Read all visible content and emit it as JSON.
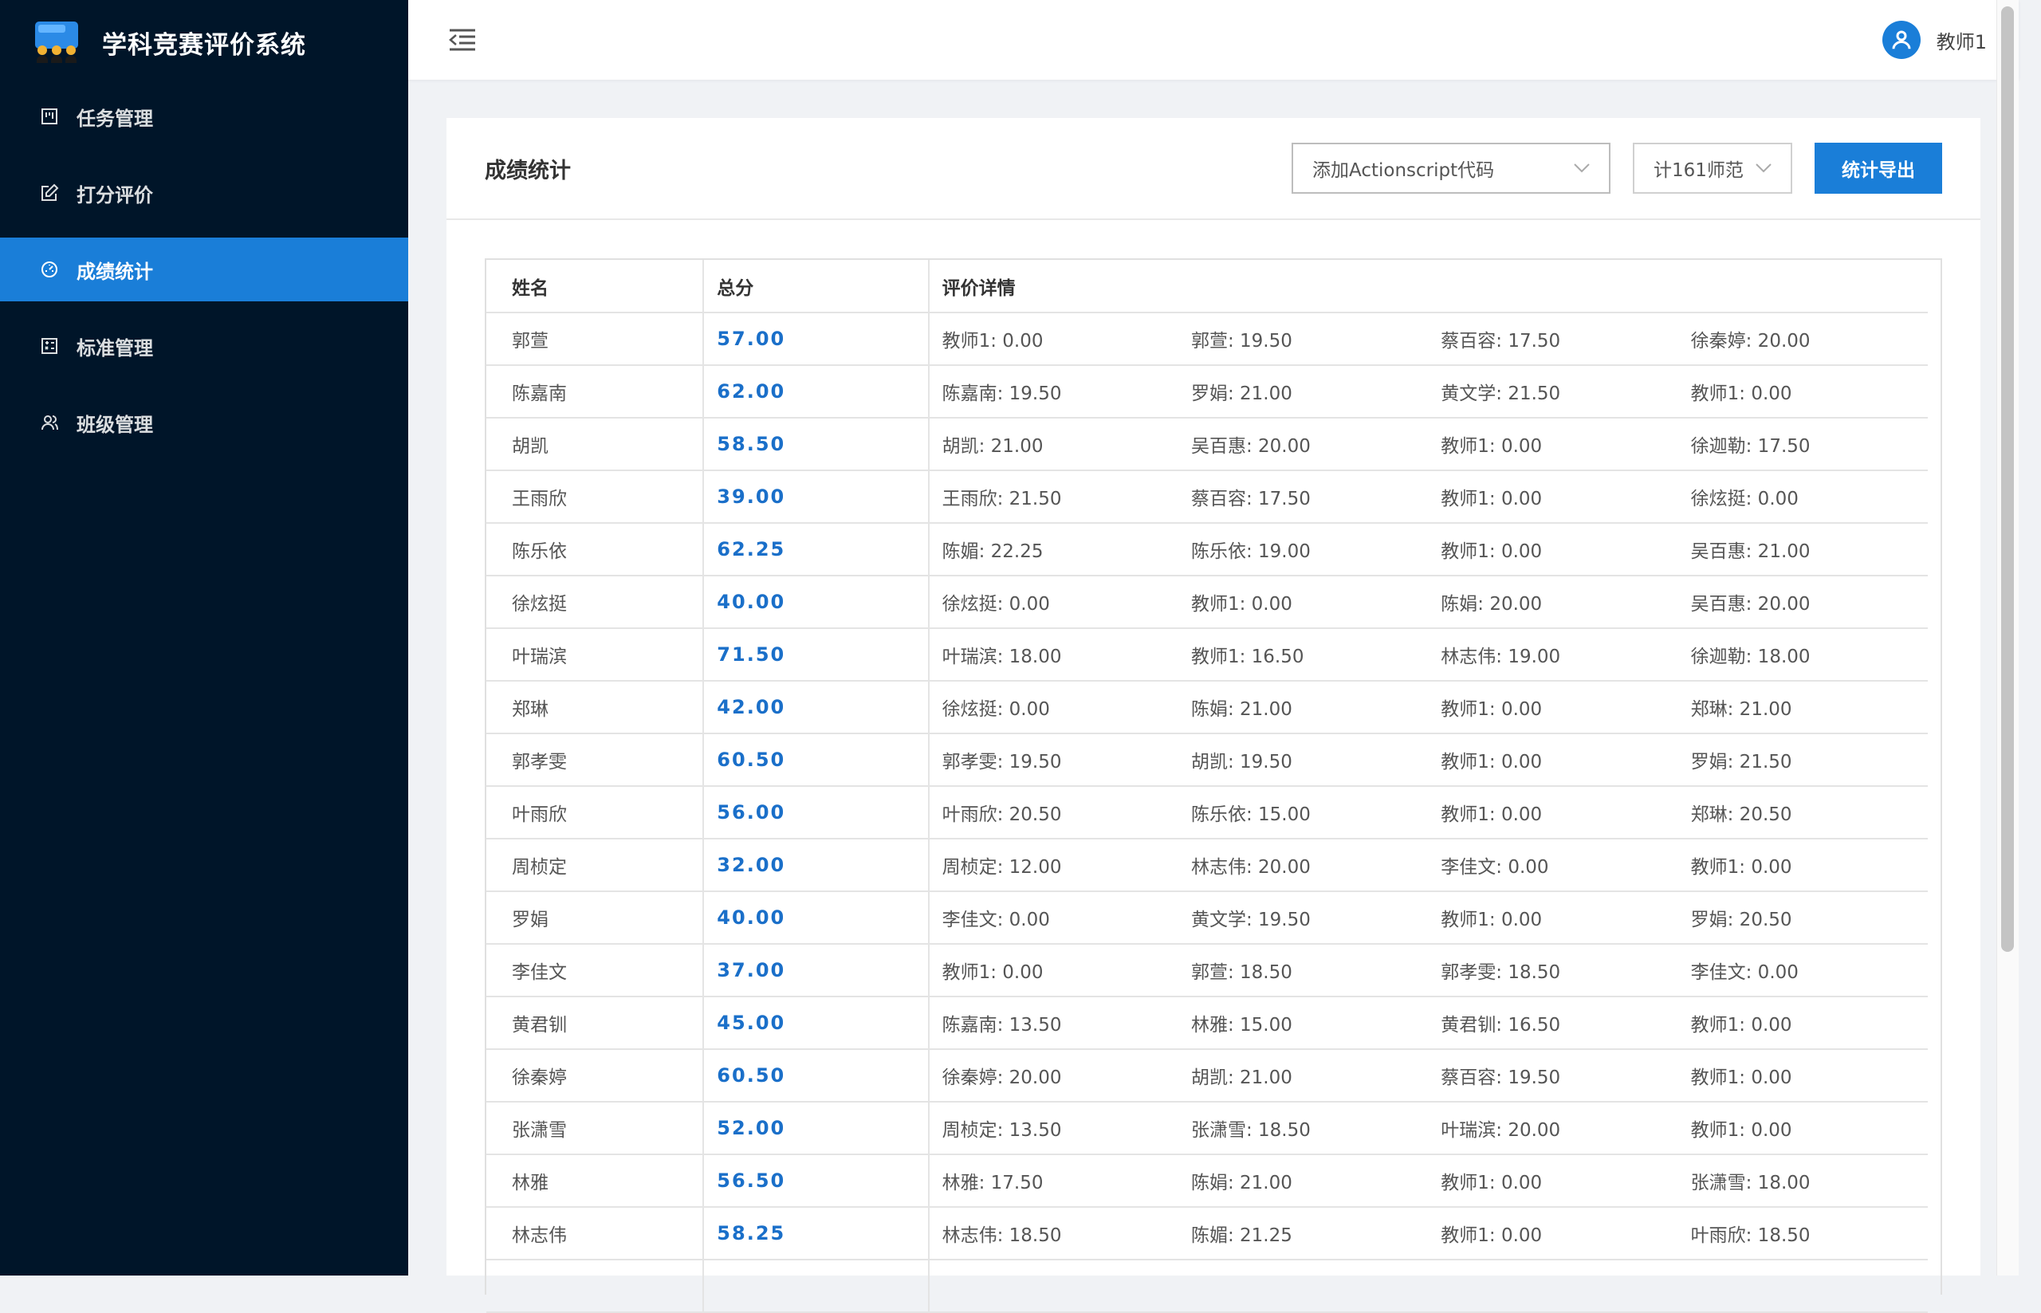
{
  "app": {
    "title": "学科竞赛评价系统"
  },
  "sidebar": {
    "items": [
      {
        "label": "任务管理",
        "icon": "task-board-icon",
        "active": false
      },
      {
        "label": "打分评价",
        "icon": "edit-icon",
        "active": false
      },
      {
        "label": "成绩统计",
        "icon": "dashboard-icon",
        "active": true
      },
      {
        "label": "标准管理",
        "icon": "calculator-icon",
        "active": false
      },
      {
        "label": "班级管理",
        "icon": "team-icon",
        "active": false
      }
    ]
  },
  "header": {
    "user_name": "教师1"
  },
  "page": {
    "title": "成绩统计",
    "task_select": "添加Actionscript代码",
    "class_select": "计161师范",
    "export_label": "统计导出"
  },
  "table": {
    "columns": [
      "姓名",
      "总分",
      "评价详情"
    ],
    "rows": [
      {
        "name": "郭萱",
        "total": "57.00",
        "details": [
          "教师1: 0.00",
          "郭萱: 19.50",
          "蔡百容: 17.50",
          "徐秦婷: 20.00"
        ]
      },
      {
        "name": "陈嘉南",
        "total": "62.00",
        "details": [
          "陈嘉南: 19.50",
          "罗娟: 21.00",
          "黄文学: 21.50",
          "教师1: 0.00"
        ]
      },
      {
        "name": "胡凯",
        "total": "58.50",
        "details": [
          "胡凯: 21.00",
          "吴百惠: 20.00",
          "教师1: 0.00",
          "徐迦勒: 17.50"
        ]
      },
      {
        "name": "王雨欣",
        "total": "39.00",
        "details": [
          "王雨欣: 21.50",
          "蔡百容: 17.50",
          "教师1: 0.00",
          "徐炫挺: 0.00"
        ]
      },
      {
        "name": "陈乐依",
        "total": "62.25",
        "details": [
          "陈媚: 22.25",
          "陈乐依: 19.00",
          "教师1: 0.00",
          "吴百惠: 21.00"
        ]
      },
      {
        "name": "徐炫挺",
        "total": "40.00",
        "details": [
          "徐炫挺: 0.00",
          "教师1: 0.00",
          "陈娟: 20.00",
          "吴百惠: 20.00"
        ]
      },
      {
        "name": "叶瑞滨",
        "total": "71.50",
        "details": [
          "叶瑞滨: 18.00",
          "教师1: 16.50",
          "林志伟: 19.00",
          "徐迦勒: 18.00"
        ]
      },
      {
        "name": "郑琳",
        "total": "42.00",
        "details": [
          "徐炫挺: 0.00",
          "陈娟: 21.00",
          "教师1: 0.00",
          "郑琳: 21.00"
        ]
      },
      {
        "name": "郭孝雯",
        "total": "60.50",
        "details": [
          "郭孝雯: 19.50",
          "胡凯: 19.50",
          "教师1: 0.00",
          "罗娟: 21.50"
        ]
      },
      {
        "name": "叶雨欣",
        "total": "56.00",
        "details": [
          "叶雨欣: 20.50",
          "陈乐依: 15.00",
          "教师1: 0.00",
          "郑琳: 20.50"
        ]
      },
      {
        "name": "周桢定",
        "total": "32.00",
        "details": [
          "周桢定: 12.00",
          "林志伟: 20.00",
          "李佳文: 0.00",
          "教师1: 0.00"
        ]
      },
      {
        "name": "罗娟",
        "total": "40.00",
        "details": [
          "李佳文: 0.00",
          "黄文学: 19.50",
          "教师1: 0.00",
          "罗娟: 20.50"
        ]
      },
      {
        "name": "李佳文",
        "total": "37.00",
        "details": [
          "教师1: 0.00",
          "郭萱: 18.50",
          "郭孝雯: 18.50",
          "李佳文: 0.00"
        ]
      },
      {
        "name": "黄君钏",
        "total": "45.00",
        "details": [
          "陈嘉南: 13.50",
          "林雅: 15.00",
          "黄君钏: 16.50",
          "教师1: 0.00"
        ]
      },
      {
        "name": "徐秦婷",
        "total": "60.50",
        "details": [
          "徐秦婷: 20.00",
          "胡凯: 21.00",
          "蔡百容: 19.50",
          "教师1: 0.00"
        ]
      },
      {
        "name": "张潇雪",
        "total": "52.00",
        "details": [
          "周桢定: 13.50",
          "张潇雪: 18.50",
          "叶瑞滨: 20.00",
          "教师1: 0.00"
        ]
      },
      {
        "name": "林雅",
        "total": "56.50",
        "details": [
          "林雅: 17.50",
          "陈娟: 21.00",
          "教师1: 0.00",
          "张潇雪: 18.00"
        ]
      },
      {
        "name": "林志伟",
        "total": "58.25",
        "details": [
          "林志伟: 18.50",
          "陈媚: 21.25",
          "教师1: 0.00",
          "叶雨欣: 18.50"
        ]
      },
      {
        "name": "",
        "total": "",
        "details": [
          "",
          "",
          "",
          ""
        ]
      }
    ]
  },
  "colors": {
    "sidebar_bg": "#001529",
    "accent": "#1a7ed8",
    "total_text": "#1a6fc9"
  }
}
